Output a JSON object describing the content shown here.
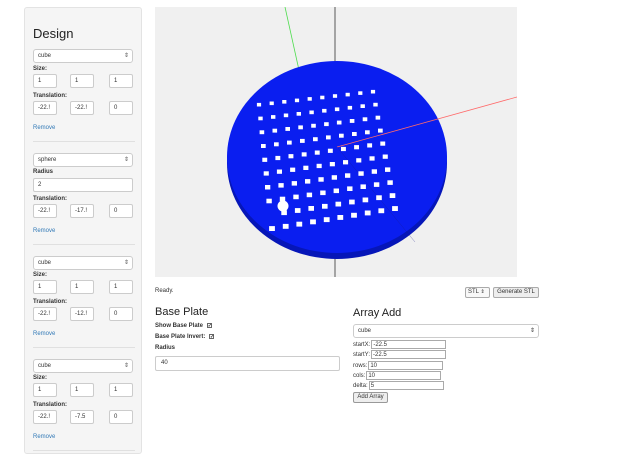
{
  "sidebar": {
    "title": "Design",
    "shapes": [
      {
        "type": "cube",
        "size_label": "Size:",
        "size": [
          "1",
          "1",
          "1"
        ],
        "translation_label": "Translation:",
        "translation": [
          "-22.!",
          "-22.!",
          "0"
        ],
        "remove": "Remove"
      },
      {
        "type": "sphere",
        "radius_label": "Radius",
        "radius": "2",
        "translation_label": "Translation:",
        "translation": [
          "-22.!",
          "-17.!",
          "0"
        ],
        "remove": "Remove"
      },
      {
        "type": "cube",
        "size_label": "Size:",
        "size": [
          "1",
          "1",
          "1"
        ],
        "translation_label": "Translation:",
        "translation": [
          "-22.!",
          "-12.!",
          "0"
        ],
        "remove": "Remove"
      },
      {
        "type": "cube",
        "size_label": "Size:",
        "size": [
          "1",
          "1",
          "1"
        ],
        "translation_label": "Translation:",
        "translation": [
          "-22.!",
          "-7.5",
          "0"
        ],
        "remove": "Remove"
      }
    ]
  },
  "viewport": {
    "plate_color": "#0a1ef0",
    "grid_rows": 10,
    "grid_cols": 10
  },
  "toolbar": {
    "status": "Ready.",
    "format": "STL",
    "generate_label": "Generate STL"
  },
  "base_plate": {
    "title": "Base Plate",
    "show_label": "Show Base Plate",
    "show_checked": true,
    "invert_label": "Base Plate Invert:",
    "invert_checked": true,
    "radius_label": "Radius",
    "radius": "40"
  },
  "array_add": {
    "title": "Array Add",
    "shape": "cube",
    "startx_label": "startX:",
    "startx": "-22.5",
    "starty_label": "startY:",
    "starty": "-22.5",
    "rows_label": "rows:",
    "rows": "10",
    "cols_label": "cols:",
    "cols": "10",
    "delta_label": "delta:",
    "delta": "5",
    "add_label": "Add Array"
  }
}
